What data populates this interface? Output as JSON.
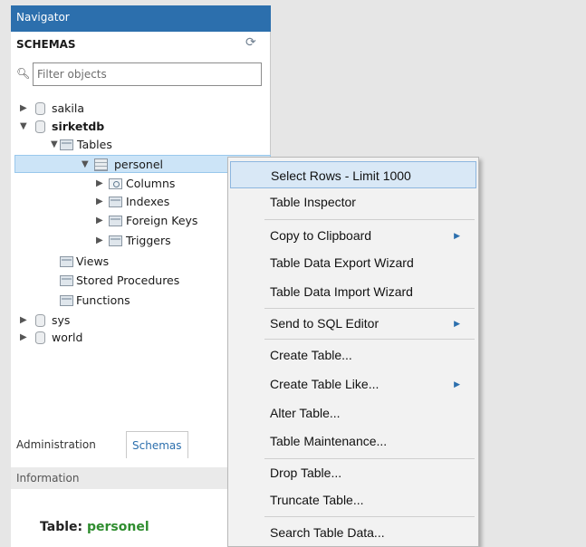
{
  "navigator": {
    "title": "Navigator",
    "schemas_label": "SCHEMAS",
    "filter_placeholder": "Filter objects",
    "tree": {
      "sakila": "sakila",
      "sirketdb": "sirketdb",
      "tables": "Tables",
      "personel": "personel",
      "columns": "Columns",
      "indexes": "Indexes",
      "foreign_keys": "Foreign Keys",
      "triggers": "Triggers",
      "views": "Views",
      "stored_procedures": "Stored Procedures",
      "functions": "Functions",
      "sys": "sys",
      "world": "world"
    }
  },
  "tabs": {
    "administration": "Administration",
    "schemas": "Schemas"
  },
  "info": {
    "header": "Information",
    "table_label": "Table:",
    "table_name": "personel"
  },
  "context_menu": {
    "items": [
      "Select Rows - Limit 1000",
      "Table Inspector",
      "Copy to Clipboard",
      "Table Data Export Wizard",
      "Table Data Import Wizard",
      "Send to SQL Editor",
      "Create Table...",
      "Create Table Like...",
      "Alter Table...",
      "Table Maintenance...",
      "Drop Table...",
      "Truncate Table...",
      "Search Table Data..."
    ]
  },
  "icons": {
    "expand": "expand-arrow-icon",
    "collapse": "collapse-arrow-icon",
    "submenu": "submenu-arrow-icon",
    "refresh": "refresh-icon",
    "search": "search-icon"
  },
  "colors": {
    "header_bg": "#2c6fad",
    "selection_bg": "#cce4f7",
    "accent_green": "#2f8d2f"
  }
}
